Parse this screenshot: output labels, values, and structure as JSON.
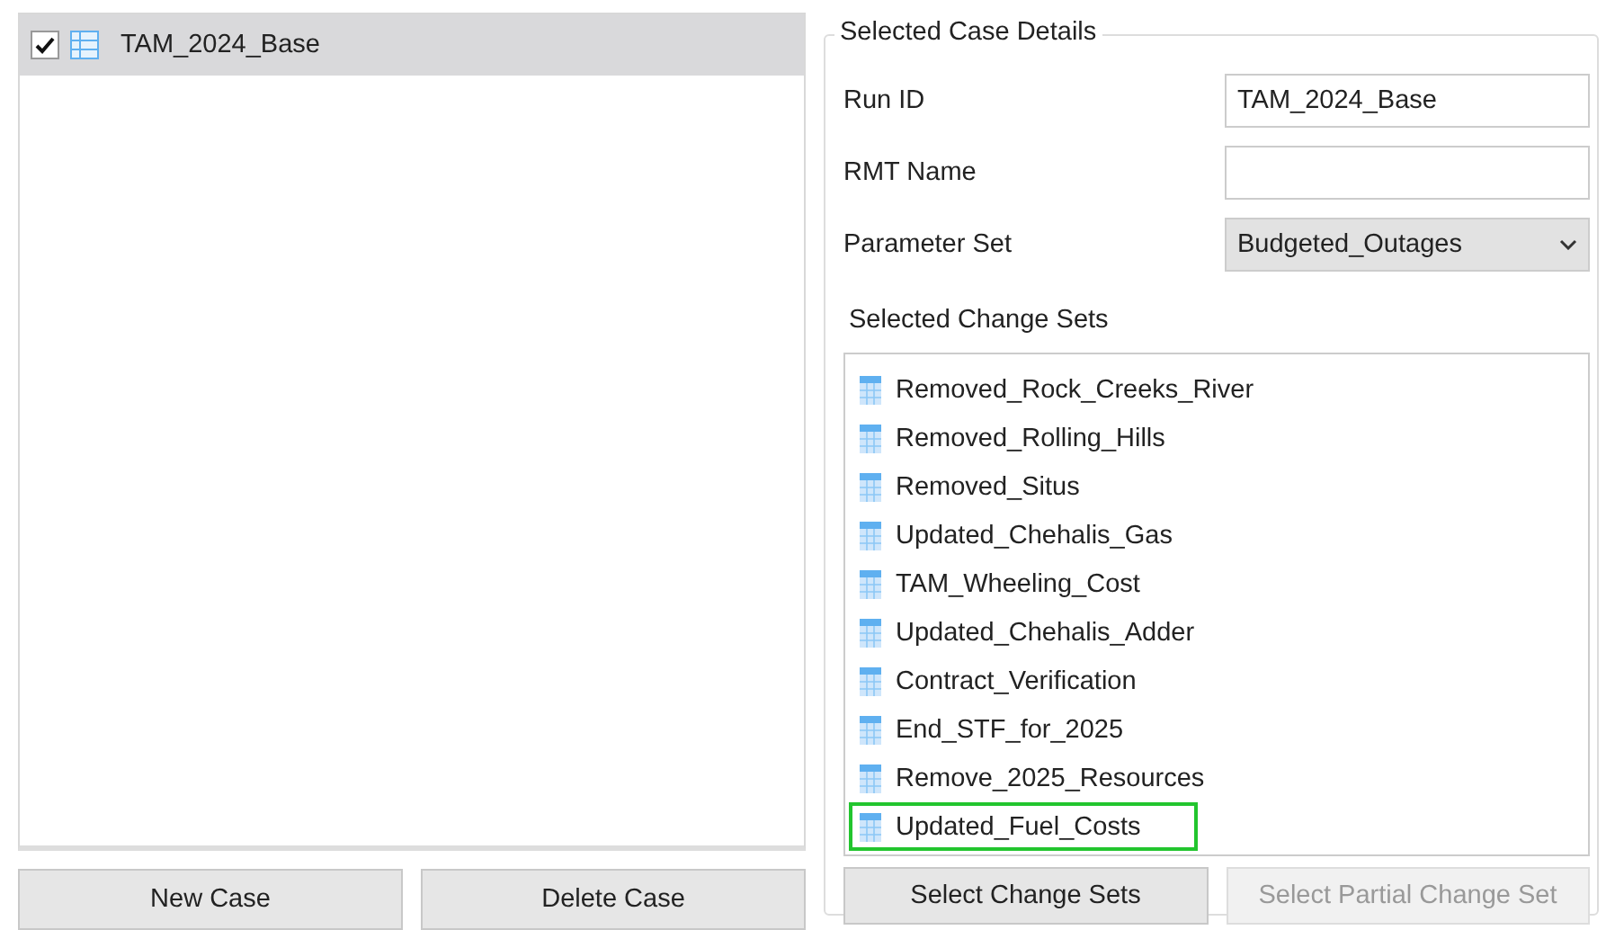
{
  "cases": [
    {
      "label": "TAM_2024_Base",
      "checked": true,
      "selected": true
    }
  ],
  "case_buttons": [
    {
      "label": "New Case",
      "disabled": false
    },
    {
      "label": "Delete Case",
      "disabled": false
    }
  ],
  "details": {
    "title": "Selected Case Details",
    "fields": [
      {
        "kind": "text",
        "label": "Run ID",
        "value": "TAM_2024_Base"
      },
      {
        "kind": "text",
        "label": "RMT Name"
      },
      {
        "kind": "select",
        "label": "Parameter Set",
        "value": "Budgeted_Outages"
      }
    ],
    "change_sets_label": "Selected Change Sets",
    "change_sets": [
      {
        "label": "Removed_Rock_Creeks_River",
        "highlighted": false
      },
      {
        "label": "Removed_Rolling_Hills",
        "highlighted": false
      },
      {
        "label": "Removed_Situs",
        "highlighted": false
      },
      {
        "label": "Updated_Chehalis_Gas",
        "highlighted": false
      },
      {
        "label": "TAM_Wheeling_Cost",
        "highlighted": false
      },
      {
        "label": "Updated_Chehalis_Adder",
        "highlighted": false
      },
      {
        "label": "Contract_Verification",
        "highlighted": false
      },
      {
        "label": "End_STF_for_2025",
        "highlighted": false
      },
      {
        "label": "Remove_2025_Resources",
        "highlighted": false
      },
      {
        "label": "Updated_Fuel_Costs",
        "highlighted": true
      }
    ],
    "buttons": [
      {
        "label": "Select Change Sets",
        "disabled": false
      },
      {
        "label": "Select Partial Change Set",
        "disabled": true
      }
    ]
  }
}
